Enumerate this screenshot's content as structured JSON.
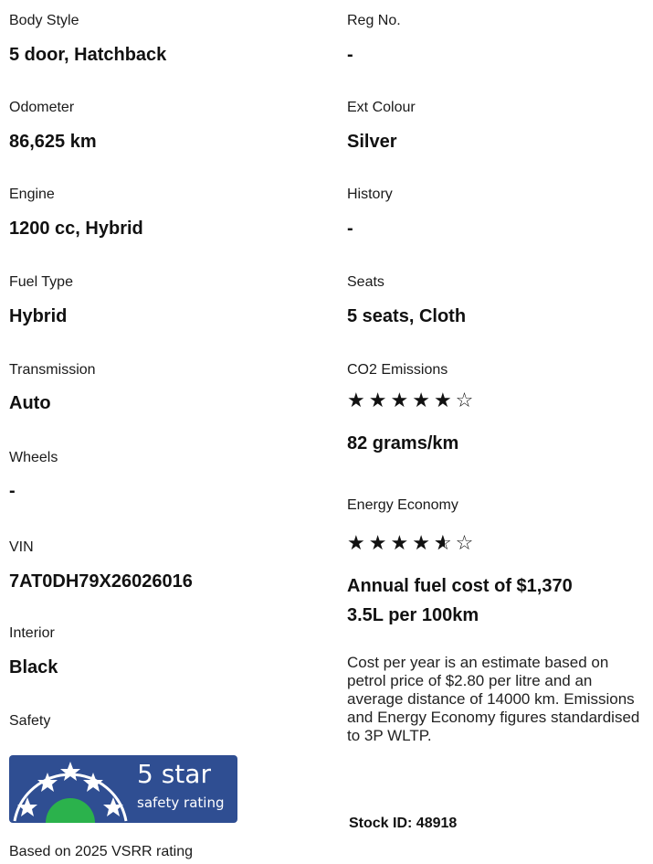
{
  "left": {
    "body_style": {
      "label": "Body Style",
      "value": "5 door, Hatchback"
    },
    "odometer": {
      "label": "Odometer",
      "value": "86,625 km"
    },
    "engine": {
      "label": "Engine",
      "value": "1200 cc, Hybrid"
    },
    "fuel_type": {
      "label": "Fuel Type",
      "value": "Hybrid"
    },
    "transmission": {
      "label": "Transmission",
      "value": "Auto"
    },
    "wheels": {
      "label": "Wheels",
      "value": "-"
    },
    "vin": {
      "label": "VIN",
      "value": "7AT0DH79X26026016"
    },
    "interior": {
      "label": "Interior",
      "value": "Black"
    },
    "safety": {
      "label": "Safety",
      "badge_title": "5 star",
      "badge_subtitle": "safety rating",
      "rating_stars": 5,
      "note": "Based on 2025 VSRR rating"
    }
  },
  "right": {
    "reg_no": {
      "label": "Reg No.",
      "value": "-"
    },
    "ext_colour": {
      "label": "Ext Colour",
      "value": "Silver"
    },
    "history": {
      "label": "History",
      "value": "-"
    },
    "seats": {
      "label": "Seats",
      "value": "5 seats, Cloth"
    },
    "co2": {
      "label": "CO2 Emissions",
      "rating": 5,
      "max": 6,
      "value": "82 grams/km"
    },
    "energy": {
      "label": "Energy Economy",
      "rating": 4.5,
      "max": 6,
      "annual_cost": "Annual fuel cost of $1,370",
      "consumption": "3.5L per 100km"
    },
    "note": "Cost per year is an estimate based on petrol price of  $2.80 per litre and an average distance of 14000 km. Emissions and Energy Economy figures standardised to 3P WLTP.",
    "stock_id": "Stock ID: 48918"
  },
  "colors": {
    "badge_bg": "#2f4e92",
    "badge_dome": "#2bb24c",
    "star_color": "#111111"
  },
  "icons": {
    "star_filled": "star-icon",
    "star_empty": "star-outline-icon",
    "star_half": "star-half-icon"
  }
}
